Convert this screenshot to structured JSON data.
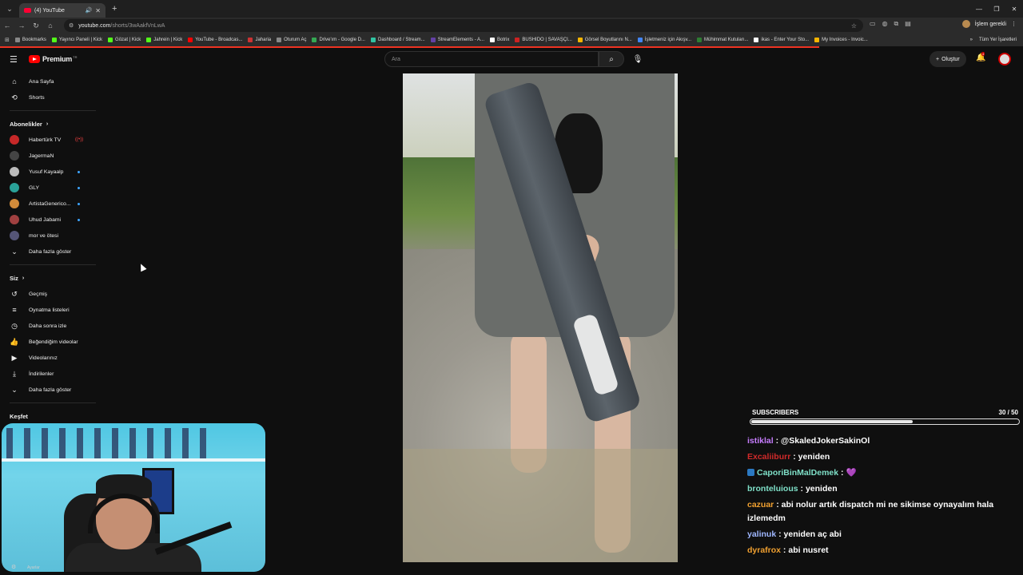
{
  "browser": {
    "tab_title": "(4) YouTube",
    "url_host": "youtube.com",
    "url_path": "/shorts/3wAakfVnLwA",
    "profile_button": "İşlem gerekli",
    "bookmarks": [
      {
        "label": "Bookmarks",
        "color": "#888888"
      },
      {
        "label": "Yayıncı Paneli | Kick",
        "color": "#53fc18"
      },
      {
        "label": "Gözat | Kick",
        "color": "#53fc18"
      },
      {
        "label": "Jahrein | Kick",
        "color": "#53fc18"
      },
      {
        "label": "YouTube - Broadcas...",
        "color": "#ff0000"
      },
      {
        "label": "Jaharia",
        "color": "#cc3333"
      },
      {
        "label": "Oturum Aç",
        "color": "#888888"
      },
      {
        "label": "Drive'ım - Google D...",
        "color": "#34a853"
      },
      {
        "label": "Dashboard / Stream...",
        "color": "#31c3a2"
      },
      {
        "label": "StreamElements - A...",
        "color": "#6441a5"
      },
      {
        "label": "Botrix",
        "color": "#ffffff"
      },
      {
        "label": "BUSHIDO | SAVAŞÇI...",
        "color": "#cc2222"
      },
      {
        "label": "Görsel Boyutlarını N...",
        "color": "#f4b400"
      },
      {
        "label": "İşletmeniz için Akışv...",
        "color": "#4285f4"
      },
      {
        "label": "Mühimmat Kutuları...",
        "color": "#2e7d32"
      },
      {
        "label": "ikas - Enter Your Sto...",
        "color": "#ffffff"
      },
      {
        "label": "My Invoices - Invoic...",
        "color": "#f4b400"
      }
    ],
    "all_bookmarks": "Tüm Yer İşaretleri"
  },
  "masthead": {
    "logo_text": "Premium",
    "logo_tr": "TR",
    "search_placeholder": "Ara",
    "create_label": "Oluştur",
    "notification_count": "4"
  },
  "sidebar": {
    "main": [
      {
        "label": "Ana Sayfa",
        "icon": "home-icon",
        "glyph": "⌂"
      },
      {
        "label": "Shorts",
        "icon": "shorts-icon",
        "glyph": "⟲"
      }
    ],
    "subs_heading": "Abonelikler",
    "subscriptions": [
      {
        "label": "Habertürk TV",
        "color": "#c62828",
        "indicator": "live"
      },
      {
        "label": "JagermaN",
        "color": "#444444",
        "indicator": "none"
      },
      {
        "label": "Yusuf Kayaalp",
        "color": "#bbbbbb",
        "indicator": "dot"
      },
      {
        "label": "GLY",
        "color": "#2aa198",
        "indicator": "dot"
      },
      {
        "label": "ArtistaGenerico...",
        "color": "#d08a3a",
        "indicator": "dot"
      },
      {
        "label": "Uhud Jabami",
        "color": "#a04040",
        "indicator": "dot"
      },
      {
        "label": "mor ve ötesi",
        "color": "#555577",
        "indicator": "none"
      }
    ],
    "show_more": "Daha fazla göster",
    "you_heading": "Siz",
    "you": [
      {
        "label": "Geçmiş",
        "icon": "history-icon",
        "glyph": "↺"
      },
      {
        "label": "Oynatma listeleri",
        "icon": "playlists-icon",
        "glyph": "≡"
      },
      {
        "label": "Daha sonra izle",
        "icon": "watch-later-icon",
        "glyph": "◷"
      },
      {
        "label": "Beğendiğim videolar",
        "icon": "like-icon",
        "glyph": "👍"
      },
      {
        "label": "Videolarınız",
        "icon": "your-videos-icon",
        "glyph": "▶"
      },
      {
        "label": "İndirilenler",
        "icon": "downloads-icon",
        "glyph": "⤓"
      },
      {
        "label": "Daha fazla göster",
        "icon": "chevron-down-icon",
        "glyph": "⌄"
      }
    ],
    "explore_heading": "Keşfet"
  },
  "webcam": {
    "bottom_label": "Ayarlar"
  },
  "subscribers": {
    "label": "SUBSCRIBERS",
    "count": "30 / 50",
    "progress": 0.6
  },
  "chat": [
    {
      "user": "istiklal",
      "color": "#c77dff",
      "text": "@SkaledJokerSakinOl",
      "badge": false
    },
    {
      "user": "Excaliiburr",
      "color": "#d12a2a",
      "text": "yeniden",
      "badge": false
    },
    {
      "user": "CaporiBinMalDemek",
      "color": "#7fe0c8",
      "text": "💜",
      "badge": true
    },
    {
      "user": "bronteluious",
      "color": "#7fe0c8",
      "text": "yeniden",
      "badge": false
    },
    {
      "user": "cazuar",
      "color": "#f0a030",
      "text": "abi nolur artık dispatch mi ne sikimse oynayalım hala izlemedm",
      "badge": false
    },
    {
      "user": "yalinuk",
      "color": "#9fb7ff",
      "text": "yeniden aç abi",
      "badge": false
    },
    {
      "user": "dyrafrox",
      "color": "#f0a030",
      "text": "abi nusret",
      "badge": false
    }
  ]
}
